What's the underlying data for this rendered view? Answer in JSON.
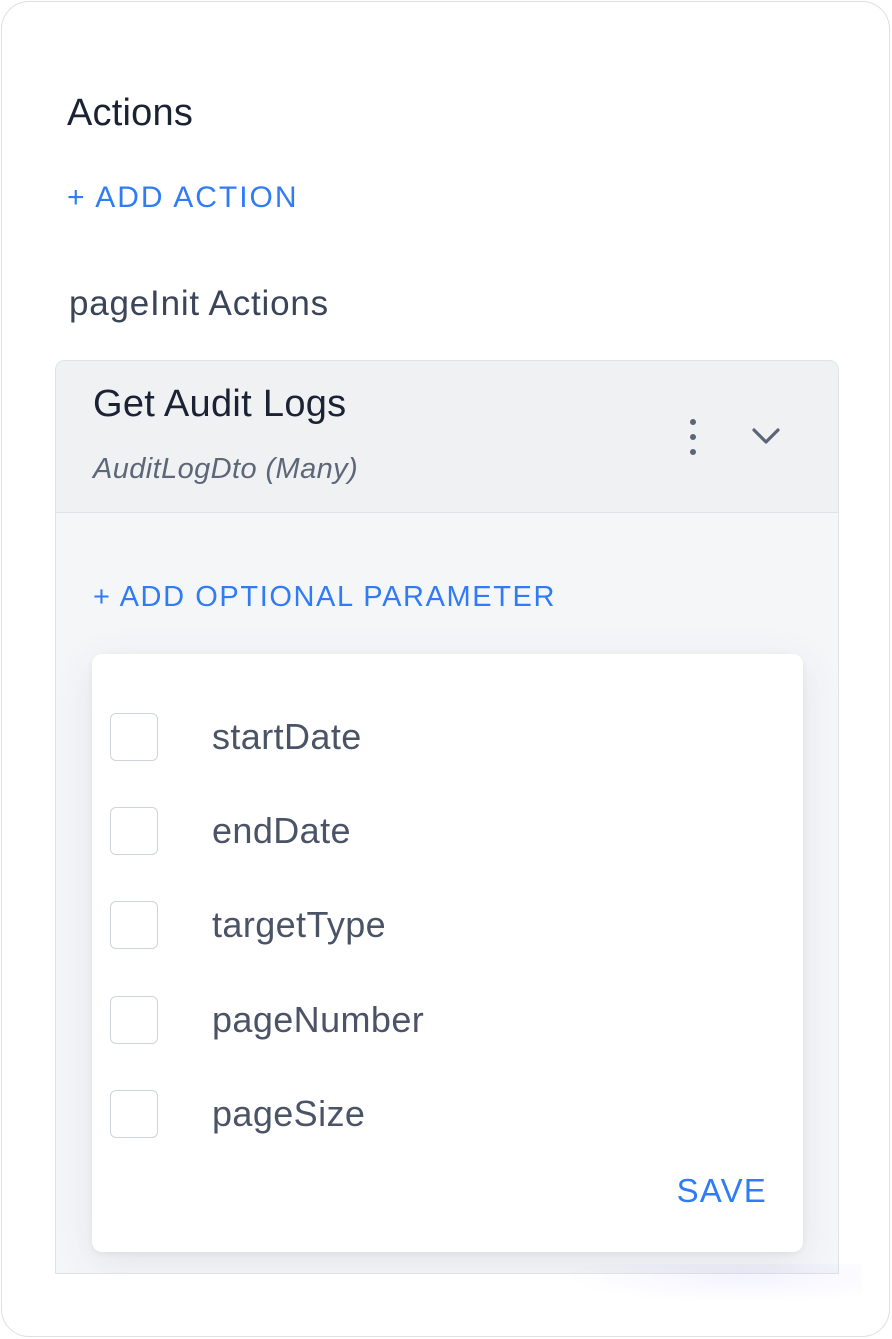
{
  "panel": {
    "title": "Actions",
    "add_action_label": "+ ADD ACTION",
    "section_title": "pageInit Actions"
  },
  "action": {
    "title": "Get Audit Logs",
    "subtitle": "AuditLogDto (Many)",
    "menu_icon": "kebab-vertical-icon",
    "expand_icon": "chevron-down-icon",
    "add_param_label": "+ ADD OPTIONAL PARAMETER",
    "parameters": [
      {
        "label": "startDate",
        "checked": false
      },
      {
        "label": "endDate",
        "checked": false
      },
      {
        "label": "targetType",
        "checked": false
      },
      {
        "label": "pageNumber",
        "checked": false
      },
      {
        "label": "pageSize",
        "checked": false
      }
    ],
    "save_label": "SAVE"
  },
  "colors": {
    "accent": "#2f7cf6",
    "heading": "#1a2233",
    "muted": "#5d6778",
    "card_background": "#f5f6f8"
  }
}
